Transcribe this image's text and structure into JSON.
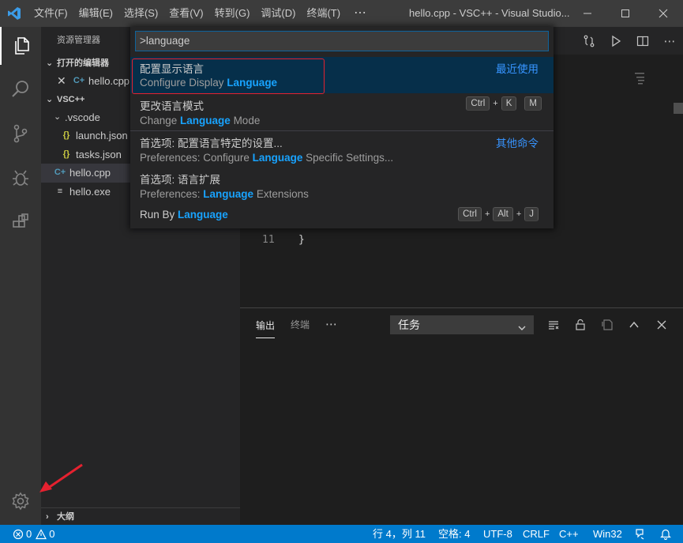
{
  "titlebar": {
    "menus": [
      "文件(F)",
      "编辑(E)",
      "选择(S)",
      "查看(V)",
      "转到(G)",
      "调试(D)",
      "终端(T)"
    ],
    "more": "⋯",
    "title": "hello.cpp - VSC++ - Visual Studio..."
  },
  "sidebar": {
    "title": "资源管理器",
    "open_editors_header": "打开的编辑器",
    "open_editor_file": "hello.cpp",
    "workspace_header": "VSC++",
    "tree": [
      {
        "label": ".vscode",
        "icon": "chevron-down-icon"
      },
      {
        "label": "launch.json",
        "icon": "json-braces-icon"
      },
      {
        "label": "tasks.json",
        "icon": "json-braces-icon"
      },
      {
        "label": "hello.cpp",
        "icon": "cpp-file-icon"
      },
      {
        "label": "hello.exe",
        "icon": "file-lines-icon"
      }
    ],
    "outline_header": "大纲"
  },
  "editor": {
    "line_number": "11",
    "line_text": "}"
  },
  "palette": {
    "input_value": ">language",
    "items": [
      {
        "label": "配置显示语言",
        "desc_pre": "Configure Display ",
        "desc_hl": "Language",
        "desc_post": "",
        "category": "最近使用"
      },
      {
        "label": "更改语言模式",
        "desc_pre": "Change ",
        "desc_hl": "Language",
        "desc_post": " Mode",
        "keys1": [
          "Ctrl",
          "K"
        ],
        "keys2": [
          "M"
        ]
      },
      {
        "label": "首选项: 配置语言特定的设置...",
        "desc_pre": "Preferences: Configure ",
        "desc_hl": "Language",
        "desc_post": " Specific Settings...",
        "category": "其他命令"
      },
      {
        "label": "首选项: 语言扩展",
        "desc_pre": "Preferences: ",
        "desc_hl": "Language",
        "desc_post": " Extensions"
      },
      {
        "label_pre": "Run By ",
        "label_hl": "Language",
        "keys": [
          "Ctrl",
          "Alt",
          "J"
        ]
      }
    ]
  },
  "panel": {
    "tabs": [
      "输出",
      "终端"
    ],
    "more": "⋯",
    "task_select": "任务"
  },
  "statusbar": {
    "errors": "0",
    "warnings": "0",
    "position": "行 4，列 11",
    "spaces": "空格: 4",
    "encoding": "UTF-8",
    "eol": "CRLF",
    "language": "C++",
    "platform": "Win32"
  },
  "colors": {
    "accent": "#007acc",
    "highlight": "#18a3ff",
    "annotation": "#e5212f"
  }
}
